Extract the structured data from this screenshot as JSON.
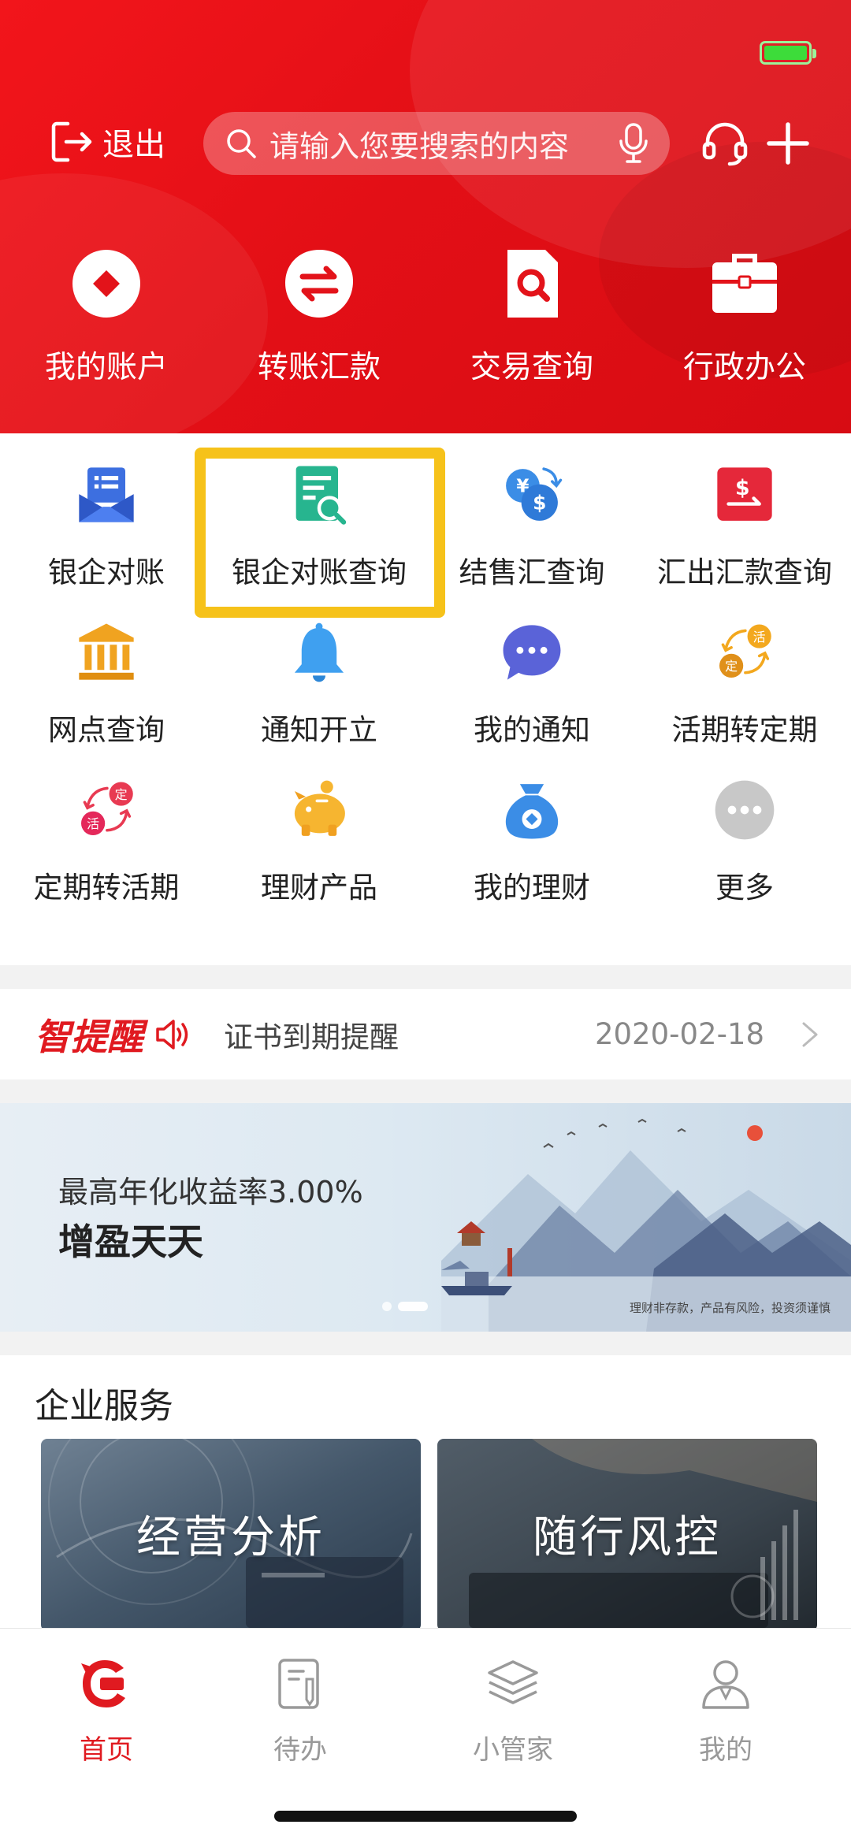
{
  "header": {
    "exit_label": "退出",
    "search_placeholder": "请输入您要搜索的内容",
    "quick_actions": [
      {
        "label": "我的账户",
        "icon": "account-icon"
      },
      {
        "label": "转账汇款",
        "icon": "transfer-icon"
      },
      {
        "label": "交易查询",
        "icon": "transaction-query-icon"
      },
      {
        "label": "行政办公",
        "icon": "briefcase-icon"
      }
    ]
  },
  "services_grid": [
    {
      "label": "银企对账",
      "icon": "reconciliation-icon"
    },
    {
      "label": "银企对账查询",
      "icon": "reconciliation-query-icon",
      "highlighted": true
    },
    {
      "label": "结售汇查询",
      "icon": "fx-settlement-icon"
    },
    {
      "label": "汇出汇款查询",
      "icon": "outward-remittance-icon"
    },
    {
      "label": "网点查询",
      "icon": "bank-branch-icon"
    },
    {
      "label": "通知开立",
      "icon": "bell-icon"
    },
    {
      "label": "我的通知",
      "icon": "message-icon"
    },
    {
      "label": "活期转定期",
      "icon": "current-to-fixed-icon"
    },
    {
      "label": "定期转活期",
      "icon": "fixed-to-current-icon"
    },
    {
      "label": "理财产品",
      "icon": "piggy-bank-icon"
    },
    {
      "label": "我的理财",
      "icon": "money-bag-icon"
    },
    {
      "label": "更多",
      "icon": "more-icon"
    }
  ],
  "reminder": {
    "brand": "智提醒",
    "text": "证书到期提醒",
    "date": "2020-02-18"
  },
  "banner": {
    "subtitle": "最高年化收益率3.00%",
    "title": "增盈天天",
    "disclaimer": "理财非存款，产品有风险，投资须谨慎",
    "page_count": 2,
    "active_page": 2
  },
  "enterprise": {
    "title": "企业服务",
    "cards": [
      {
        "label": "经营分析"
      },
      {
        "label": "随行风控"
      }
    ]
  },
  "tabbar": {
    "tabs": [
      {
        "label": "首页",
        "active": true
      },
      {
        "label": "待办",
        "active": false
      },
      {
        "label": "小管家",
        "active": false
      },
      {
        "label": "我的",
        "active": false
      }
    ]
  },
  "colors": {
    "brand_red": "#e01a20",
    "highlight_yellow": "#f6c21a",
    "battery_green": "#3ddc3a"
  }
}
